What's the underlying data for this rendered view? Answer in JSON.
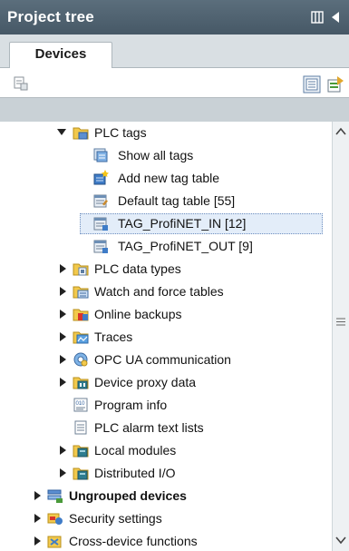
{
  "window": {
    "title": "Project tree"
  },
  "tabs": [
    {
      "label": "Devices"
    }
  ],
  "colors": {
    "titlebar": "#4f6271",
    "selection": "#e3edf9",
    "folder": "#f2c94c"
  },
  "tree": {
    "rows": [
      {
        "label": "PLC tags",
        "expanded": true,
        "icon": "plc-tags-folder-icon"
      },
      {
        "label": "Show all tags",
        "icon": "show-all-tags-icon"
      },
      {
        "label": "Add new tag table",
        "icon": "add-tag-table-icon"
      },
      {
        "label": "Default tag table [55]",
        "icon": "tag-table-icon"
      },
      {
        "label": "TAG_ProfiNET_IN [12]",
        "icon": "tag-table-icon",
        "selected": true
      },
      {
        "label": "TAG_ProfiNET_OUT [9]",
        "icon": "tag-table-icon"
      },
      {
        "label": "PLC data types",
        "icon": "plc-data-types-icon"
      },
      {
        "label": "Watch and force tables",
        "icon": "watch-tables-icon"
      },
      {
        "label": "Online backups",
        "icon": "online-backups-icon"
      },
      {
        "label": "Traces",
        "icon": "traces-icon"
      },
      {
        "label": "OPC UA communication",
        "icon": "opc-ua-icon"
      },
      {
        "label": "Device proxy data",
        "icon": "device-proxy-icon"
      },
      {
        "label": "Program info",
        "icon": "program-info-icon"
      },
      {
        "label": "PLC alarm text lists",
        "icon": "alarm-text-icon"
      },
      {
        "label": "Local modules",
        "icon": "local-modules-icon"
      },
      {
        "label": "Distributed I/O",
        "icon": "distributed-io-icon"
      },
      {
        "label": "Ungrouped devices",
        "icon": "ungrouped-devices-icon"
      },
      {
        "label": "Security settings",
        "icon": "security-settings-icon"
      },
      {
        "label": "Cross-device functions",
        "icon": "cross-device-icon"
      }
    ]
  }
}
